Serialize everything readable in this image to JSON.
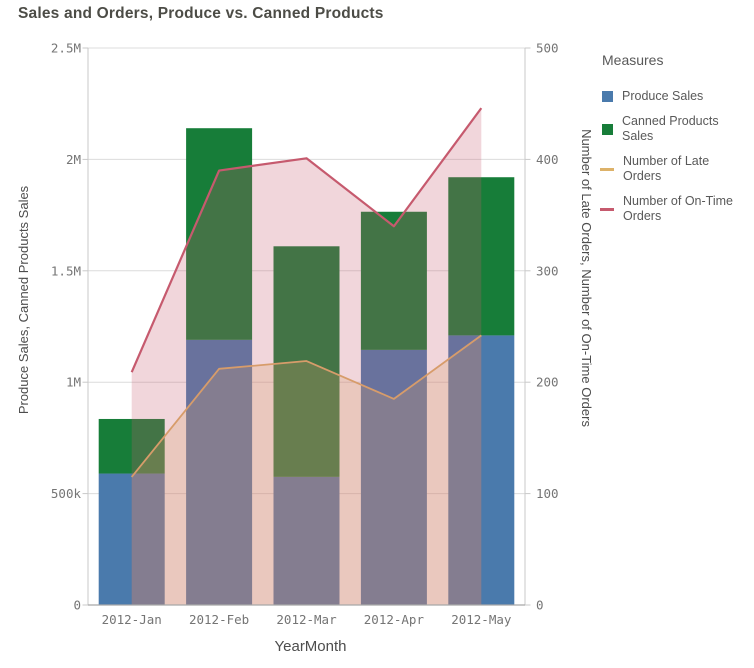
{
  "title": "Sales and Orders, Produce vs. Canned Products",
  "legend": {
    "title": "Measures",
    "items": [
      {
        "label": "Produce Sales",
        "swatch": "square",
        "color": "#4a7aac"
      },
      {
        "label": "Canned Products Sales",
        "swatch": "square",
        "color": "#177d39"
      },
      {
        "label": "Number of Late Orders",
        "swatch": "line",
        "color": "#ddb269"
      },
      {
        "label": "Number of On-Time Orders",
        "swatch": "line",
        "color": "#c65a6e"
      }
    ]
  },
  "chart_data": {
    "type": "combo",
    "categories": [
      "2012-Jan",
      "2012-Feb",
      "2012-Mar",
      "2012-Apr",
      "2012-May"
    ],
    "series": [
      {
        "name": "Produce Sales",
        "type": "bar",
        "stack": "sales",
        "axis": "left",
        "color": "#4a7aac",
        "values": [
          590000,
          1190000,
          575000,
          1145000,
          1210000
        ]
      },
      {
        "name": "Canned Products Sales",
        "type": "bar",
        "stack": "sales",
        "axis": "left",
        "color": "#177d39",
        "values": [
          245000,
          950000,
          1035000,
          620000,
          710000
        ]
      },
      {
        "name": "Number of Late Orders",
        "type": "area-line",
        "axis": "right",
        "color": "#ddb269",
        "fill_opacity": 0.25,
        "values": [
          115,
          212,
          219,
          185,
          242
        ]
      },
      {
        "name": "Number of On-Time Orders",
        "type": "area-line",
        "axis": "right",
        "color": "#c65a6e",
        "fill_opacity": 0.25,
        "values": [
          209,
          390,
          401,
          340,
          446
        ]
      }
    ],
    "xlabel": "YearMonth",
    "ylabel_left": "Produce Sales, Canned Products Sales",
    "ylabel_right": "Number of Late Orders, Number of On-Time Orders",
    "left_axis": {
      "min": 0,
      "max": 2500000,
      "tick_labels": [
        "0",
        "500k",
        "1M",
        "1.5M",
        "2M",
        "2.5M"
      ],
      "tick_values": [
        0,
        500000,
        1000000,
        1500000,
        2000000,
        2500000
      ]
    },
    "right_axis": {
      "min": 0,
      "max": 500,
      "tick_labels": [
        "0",
        "100",
        "200",
        "300",
        "400",
        "500"
      ],
      "tick_values": [
        0,
        100,
        200,
        300,
        400,
        500
      ]
    },
    "grid": true,
    "legend_position": "right"
  },
  "colors": {
    "title": "#4c4c46",
    "axis_title": "#4d4d4d",
    "tick_label": "#757575",
    "gridline": "#dcdcdc",
    "axis_line": "#c9c9c9",
    "x_axis_line": "#a8a8a8"
  }
}
